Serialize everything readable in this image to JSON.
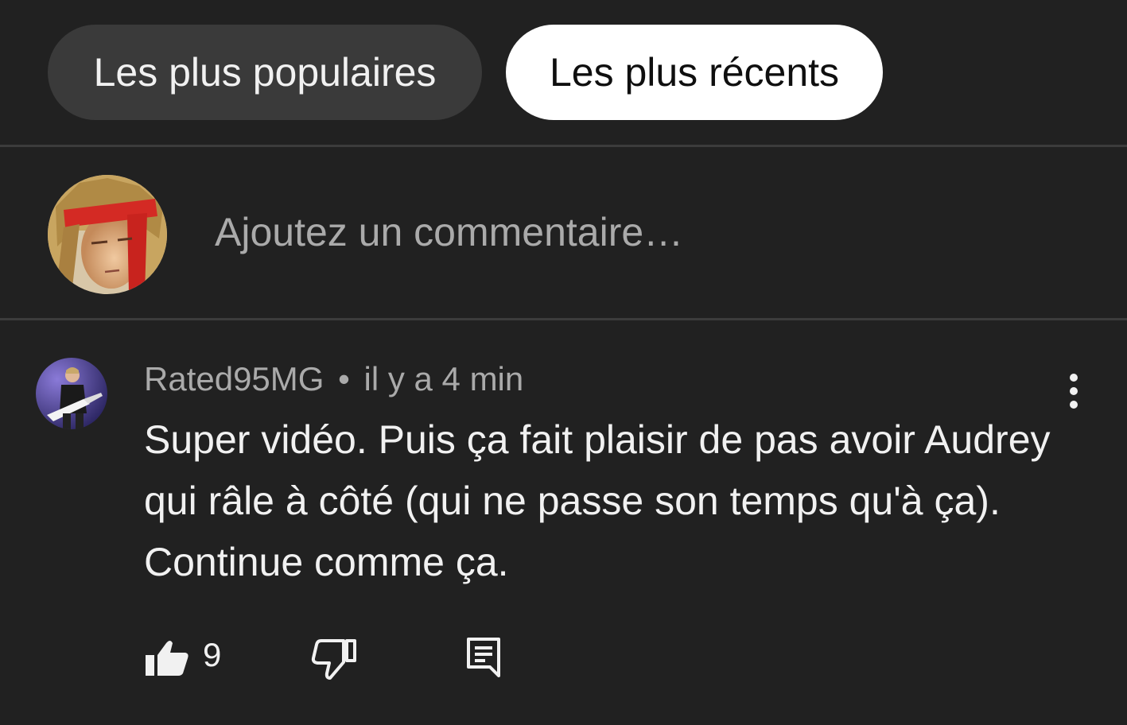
{
  "filters": {
    "popular_label": "Les plus populaires",
    "recent_label": "Les plus récents",
    "selected": "Les plus récents"
  },
  "compose": {
    "placeholder": "Ajoutez un commentaire…"
  },
  "comment": {
    "author": "Rated95MG",
    "separator": "•",
    "time": "il y a 4 min",
    "text": "Super vidéo. Puis ça fait plaisir de pas avoir Audrey qui râle à côté (qui ne passe son temps qu'à ça). Continue comme ça.",
    "like_count": "9"
  },
  "colors": {
    "background": "#212121",
    "chip_inactive": "#3a3a3a",
    "chip_active": "#ffffff",
    "secondary_text": "#aaaaaa"
  },
  "icons": {
    "like": "thumbs-up-icon",
    "dislike": "thumbs-down-icon",
    "reply": "comment-reply-icon",
    "more": "more-vertical-icon"
  }
}
